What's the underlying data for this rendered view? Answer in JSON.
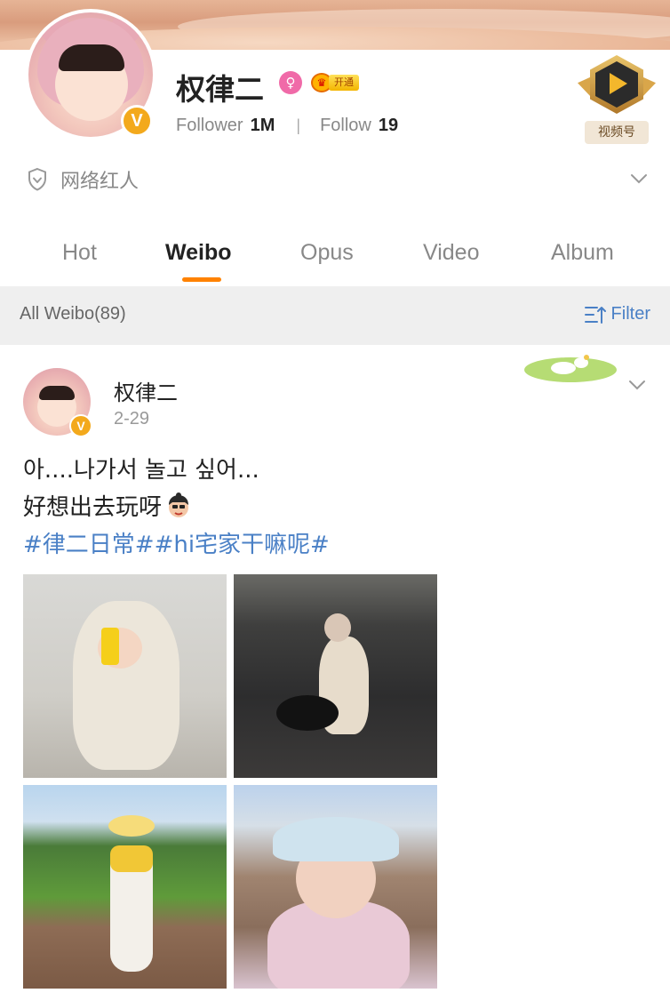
{
  "profile": {
    "name": "权律二",
    "vip_label": "开通",
    "follower_label": "Follower",
    "follower_value": "1M",
    "follow_label": "Follow",
    "follow_value": "19",
    "verified_mark": "V",
    "verify_text": "网络红人",
    "video_button_label": "视频号"
  },
  "tabs": [
    {
      "label": "Hot",
      "active": false
    },
    {
      "label": "Weibo",
      "active": true
    },
    {
      "label": "Opus",
      "active": false
    },
    {
      "label": "Video",
      "active": false
    },
    {
      "label": "Album",
      "active": false
    }
  ],
  "filter_bar": {
    "count_label": "All Weibo(89)",
    "filter_label": "Filter"
  },
  "post": {
    "author": "权律二",
    "time": "2-29",
    "verified_mark": "V",
    "lines": [
      "아....나가서 놀고 싶어...",
      "好想出去玩呀"
    ],
    "hashtags": "#律二日常##hi宅家干嘛呢#",
    "photos": [
      "photo-1",
      "photo-2",
      "photo-3",
      "photo-4"
    ]
  },
  "colors": {
    "accent_orange": "#ff8200",
    "link_blue": "#4a80c6",
    "verified_gold": "#f3a91c",
    "gender_pink": "#f06aa8"
  },
  "icons": {
    "shield": "shield-icon",
    "chevron": "chevron-down-icon",
    "filter": "filter-icon",
    "gender": "female-icon",
    "vip": "crown-icon",
    "video": "video-channel-icon"
  }
}
